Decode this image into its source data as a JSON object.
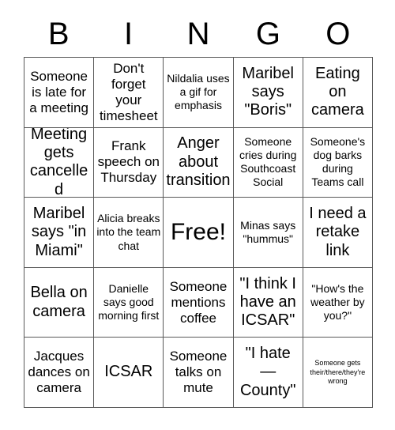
{
  "header": {
    "letters": [
      "B",
      "I",
      "N",
      "G",
      "O"
    ]
  },
  "grid": {
    "columns": 5,
    "rows": 5,
    "cells": [
      {
        "text": "Someone is late for a meeting",
        "size": "md",
        "free": false
      },
      {
        "text": "Don't forget your timesheet",
        "size": "md",
        "free": false
      },
      {
        "text": "Nildalia uses a gif for emphasis",
        "size": "sm",
        "free": false
      },
      {
        "text": "Maribel says \"Boris\"",
        "size": "lg",
        "free": false
      },
      {
        "text": "Eating on camera",
        "size": "lg",
        "free": false
      },
      {
        "text": "Meeting gets cancelled",
        "size": "lg",
        "free": false
      },
      {
        "text": "Frank speech on Thursday",
        "size": "md",
        "free": false
      },
      {
        "text": "Anger about transition",
        "size": "lg",
        "free": false
      },
      {
        "text": "Someone cries during Southcoast Social",
        "size": "sm",
        "free": false
      },
      {
        "text": "Someone's dog barks during Teams call",
        "size": "sm",
        "free": false
      },
      {
        "text": "Maribel says \"in Miami\"",
        "size": "lg",
        "free": false
      },
      {
        "text": "Alicia breaks into the team chat",
        "size": "sm",
        "free": false
      },
      {
        "text": "Free!",
        "size": "xl",
        "free": true
      },
      {
        "text": "Minas says \"hummus\"",
        "size": "sm",
        "free": false
      },
      {
        "text": "I need a retake link",
        "size": "lg",
        "free": false
      },
      {
        "text": "Bella on camera",
        "size": "lg",
        "free": false
      },
      {
        "text": "Danielle says good morning first",
        "size": "sm",
        "free": false
      },
      {
        "text": "Someone mentions coffee",
        "size": "md",
        "free": false
      },
      {
        "text": "\"I think I have an ICSAR\"",
        "size": "lg",
        "free": false
      },
      {
        "text": "\"How's the weather by you?\"",
        "size": "sm",
        "free": false
      },
      {
        "text": "Jacques dances on camera",
        "size": "md",
        "free": false
      },
      {
        "text": "ICSAR",
        "size": "lg",
        "free": false
      },
      {
        "text": "Someone talks on mute",
        "size": "md",
        "free": false
      },
      {
        "text": "\"I hate\n—\nCounty\"",
        "size": "lg",
        "free": false
      },
      {
        "text": "Someone gets their/there/they're wrong",
        "size": "xs",
        "free": false
      }
    ]
  },
  "colors": {
    "border": "#595959",
    "text": "#000000",
    "background": "#ffffff"
  }
}
